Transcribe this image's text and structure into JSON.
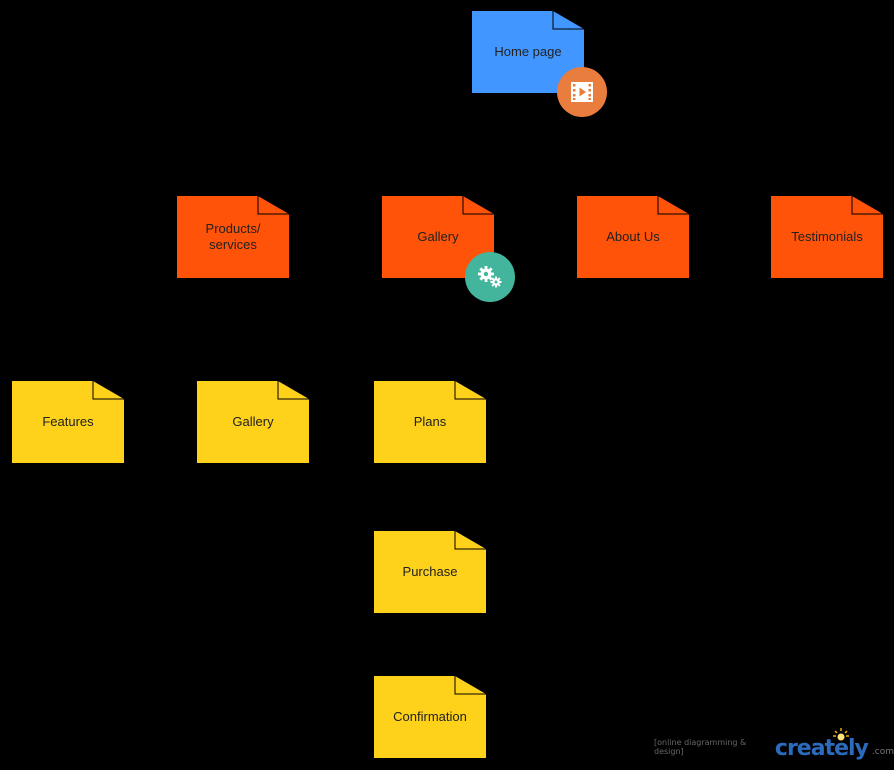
{
  "colors": {
    "background": "#000000",
    "root_fill": "#4196ff",
    "level1_fill": "#fe5308",
    "level2_fill": "#fed11b",
    "video_badge": "#e97d3e",
    "gear_badge": "#44b59d",
    "connector": "#000000"
  },
  "diagram": {
    "nodes": [
      {
        "id": "home",
        "label": "Home page",
        "level": 0
      },
      {
        "id": "products",
        "label": "Products/ services",
        "level": 1
      },
      {
        "id": "gallery",
        "label": "Gallery",
        "level": 1
      },
      {
        "id": "about",
        "label": "About Us",
        "level": 1
      },
      {
        "id": "testimonials",
        "label": "Testimonials",
        "level": 1
      },
      {
        "id": "features",
        "label": "Features",
        "level": 2
      },
      {
        "id": "gallery2",
        "label": "Gallery",
        "level": 2
      },
      {
        "id": "plans",
        "label": "Plans",
        "level": 2
      },
      {
        "id": "purchase",
        "label": "Purchase",
        "level": 2
      },
      {
        "id": "confirmation",
        "label": "Confirmation",
        "level": 2
      }
    ],
    "edges": [
      [
        "home",
        "products"
      ],
      [
        "home",
        "gallery"
      ],
      [
        "home",
        "about"
      ],
      [
        "home",
        "testimonials"
      ],
      [
        "products",
        "features"
      ],
      [
        "products",
        "gallery2"
      ],
      [
        "products",
        "plans"
      ],
      [
        "plans",
        "purchase"
      ],
      [
        "purchase",
        "confirmation"
      ]
    ],
    "badges": [
      {
        "node": "home",
        "icon": "video-icon"
      },
      {
        "node": "gallery",
        "icon": "gears-icon"
      }
    ]
  },
  "watermark": {
    "tagline": "[online diagramming & design]",
    "brand": "creately",
    "brand_main": "creat",
    "brand_e": "e",
    "brand_ly": "ly",
    "domain": ".com"
  }
}
